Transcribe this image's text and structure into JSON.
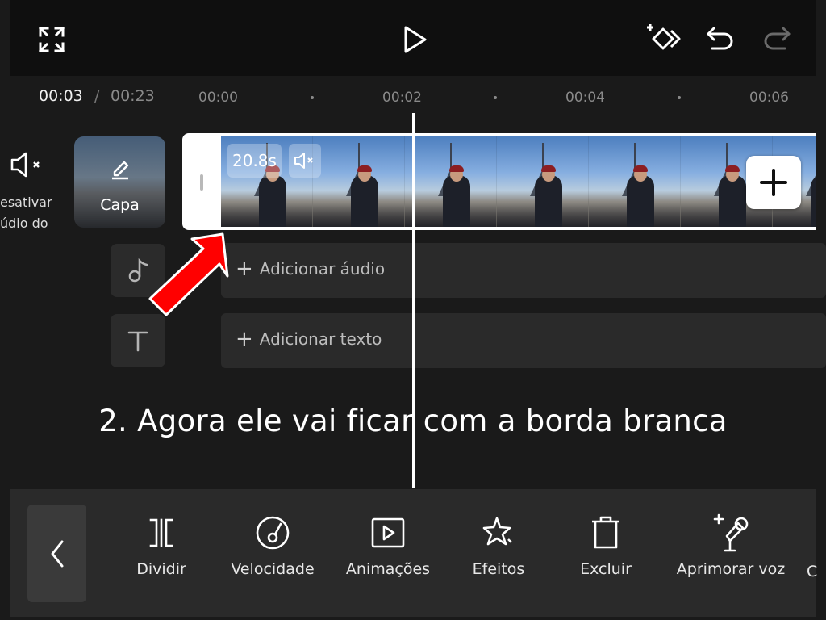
{
  "top_bar": {
    "fullscreen_icon": "fullscreen-icon",
    "play_icon": "play-icon",
    "keyframe_icon": "keyframe-icon",
    "undo_icon": "undo-icon",
    "redo_icon": "redo-icon"
  },
  "timeline": {
    "current_time": "00:03",
    "separator": "/",
    "total_time": "00:23",
    "ticks": [
      "00:00",
      "00:02",
      "00:04",
      "00:06"
    ]
  },
  "mute_track": {
    "label_line1": "esativar",
    "label_line2": "údio do"
  },
  "cover": {
    "label": "Capa"
  },
  "clip": {
    "duration": "20.8s",
    "frame_count": 7
  },
  "audio_track": {
    "add_label": "Adicionar áudio"
  },
  "text_track": {
    "add_label": "Adicionar texto"
  },
  "caption": "2. Agora ele vai ficar com a borda branca",
  "toolbar": {
    "items": [
      {
        "label": "Dividir",
        "icon": "split-icon"
      },
      {
        "label": "Velocidade",
        "icon": "speed-icon"
      },
      {
        "label": "Animações",
        "icon": "animation-icon"
      },
      {
        "label": "Efeitos",
        "icon": "effects-icon"
      },
      {
        "label": "Excluir",
        "icon": "delete-icon"
      },
      {
        "label": "Aprimorar voz",
        "icon": "enhance-voice-icon"
      }
    ],
    "cut_off_label": "C"
  },
  "colors": {
    "background": "#1a1a1a",
    "top_bar": "#0f0f0f",
    "toolbar": "#2a2a2a",
    "annotation_arrow": "#ff0000",
    "clip_border": "#ffffff"
  }
}
